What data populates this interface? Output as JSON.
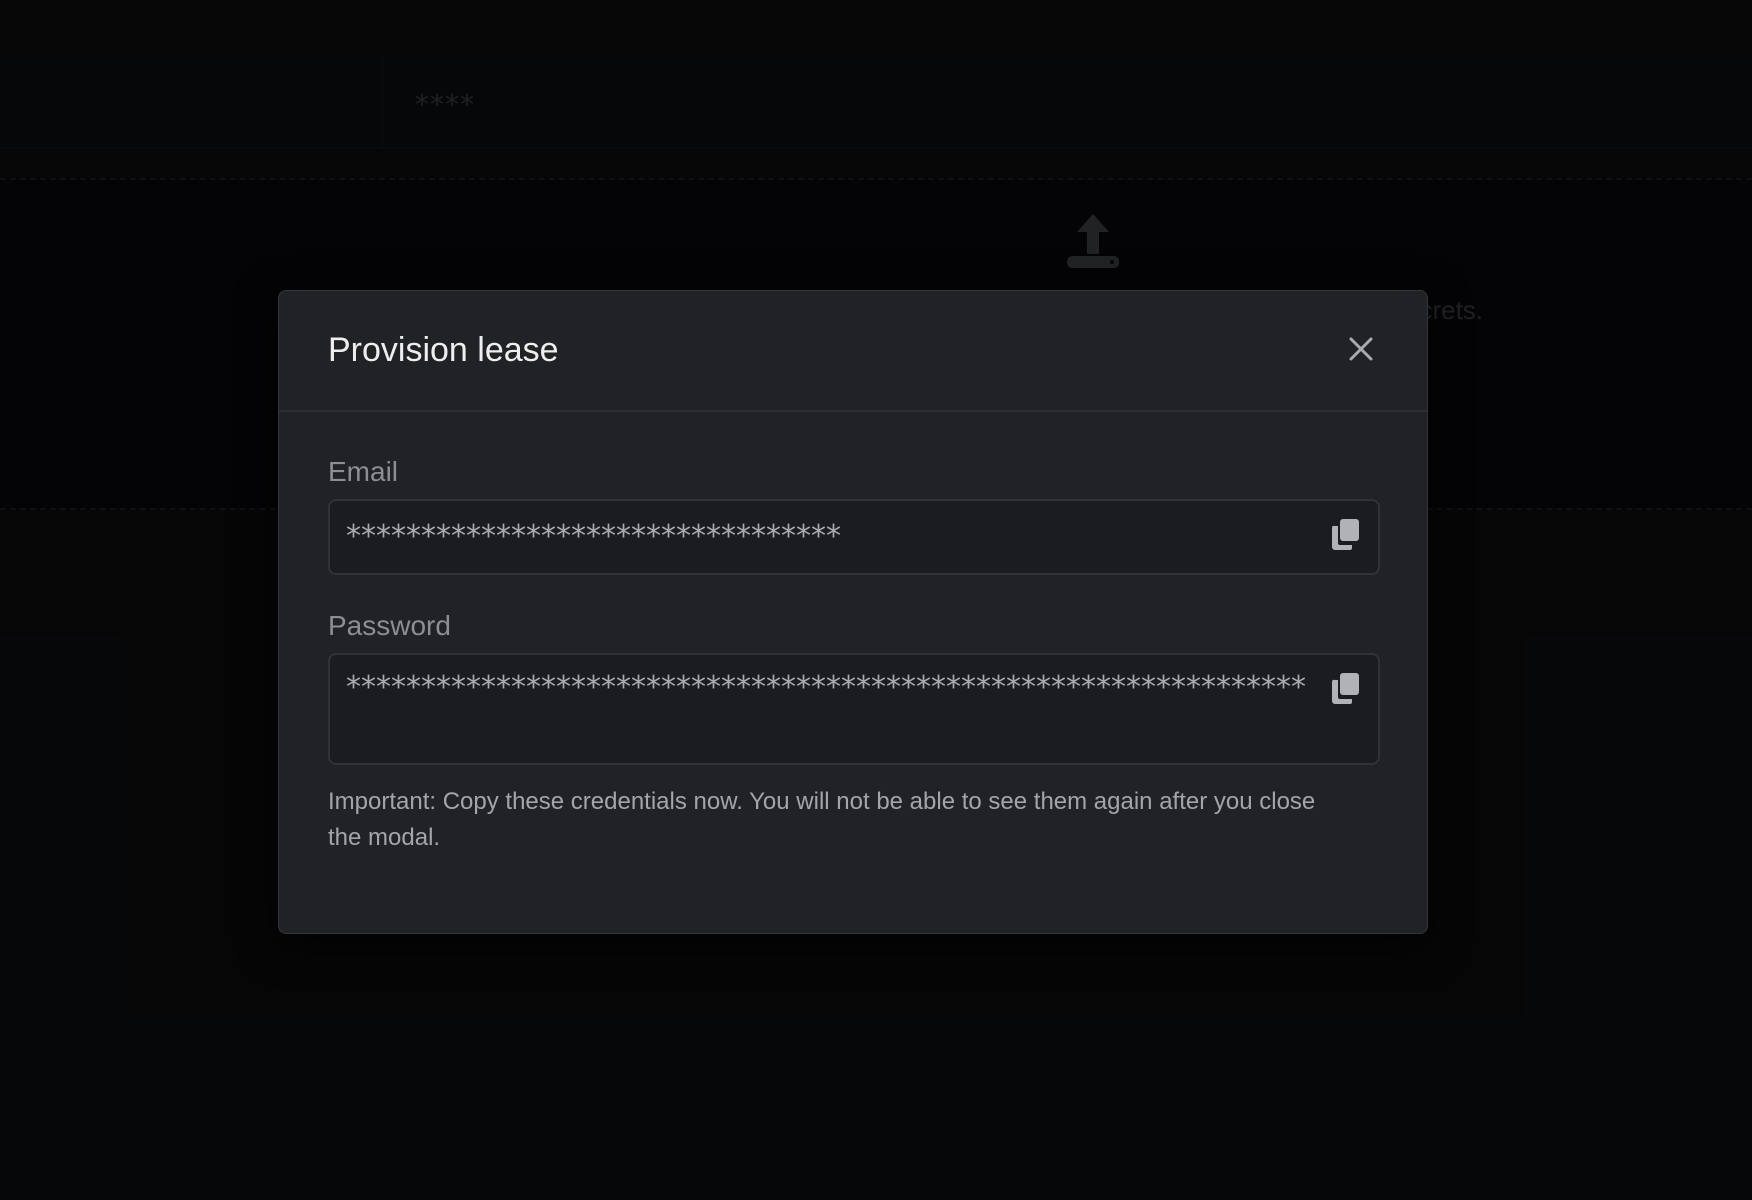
{
  "background": {
    "table": {
      "masked_value": "****"
    },
    "dropzone": {
      "text_fragment": "ecrets.",
      "icon": "upload-icon"
    }
  },
  "modal": {
    "title": "Provision lease",
    "close_icon": "close-icon",
    "fields": [
      {
        "label": "Email",
        "value": "*********************************",
        "copy_icon": "copy-icon"
      },
      {
        "label": "Password",
        "value": "****************************************************************",
        "copy_icon": "copy-icon"
      }
    ],
    "notice": "Important: Copy these credentials now. You will not be able to see them again after you close the modal."
  },
  "colors": {
    "modal_background": "#212225",
    "field_background": "#1b1c1f",
    "page_background": "#0b0c0e"
  }
}
